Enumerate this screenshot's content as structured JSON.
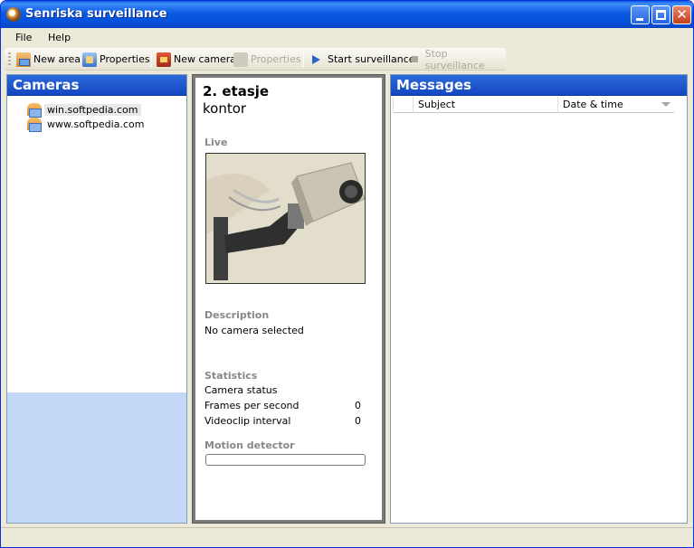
{
  "window": {
    "title": "Senriska surveillance"
  },
  "menu": {
    "items": [
      "File",
      "Help"
    ]
  },
  "toolbar": {
    "new_area": "New area",
    "properties": "Properties",
    "new_camera": "New camera",
    "properties_camera": "Properties",
    "start_surveillance": "Start surveillance",
    "stop_surveillance": "Stop surveillance"
  },
  "cameras": {
    "header": "Cameras",
    "items": [
      {
        "label": "win.softpedia.com",
        "selected": true
      },
      {
        "label": "www.softpedia.com",
        "selected": false
      }
    ]
  },
  "detail": {
    "title": "2. etasje",
    "subtitle": "kontor",
    "live_label": "Live",
    "description_label": "Description",
    "description_text": "No camera selected",
    "statistics_label": "Statistics",
    "camera_status_label": "Camera status",
    "fps_label": "Frames per second",
    "fps_value": "0",
    "videoclip_label": "Videoclip interval",
    "videoclip_value": "0",
    "motion_label": "Motion detector",
    "motion_level": 0
  },
  "messages": {
    "header": "Messages",
    "columns": [
      "Subject",
      "Date & time"
    ]
  },
  "colors": {
    "accent": "#1347c2",
    "selection_bg": "#c4d8f7"
  }
}
